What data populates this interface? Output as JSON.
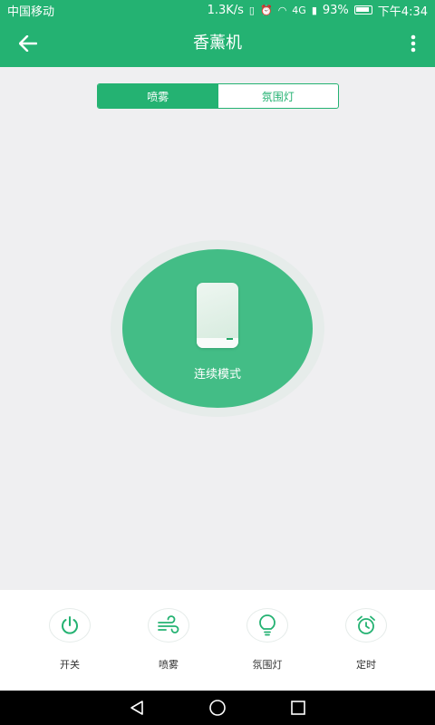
{
  "status_bar": {
    "carrier": "中国移动",
    "speed": "1.3K/s",
    "signal_text": "4G",
    "battery": "93%",
    "time": "下午4:34"
  },
  "header": {
    "title": "香薰机",
    "back_icon": "arrow-left-icon",
    "more_icon": "more-vertical-icon"
  },
  "tabs": [
    {
      "label": "喷雾",
      "active": true
    },
    {
      "label": "氛围灯",
      "active": false
    }
  ],
  "mode": {
    "label": "连续模式",
    "icon": "diffuser-device-icon"
  },
  "controls": [
    {
      "label": "开关",
      "icon": "power-icon"
    },
    {
      "label": "喷雾",
      "icon": "wind-icon"
    },
    {
      "label": "氛围灯",
      "icon": "bulb-icon"
    },
    {
      "label": "定时",
      "icon": "alarm-clock-icon"
    }
  ],
  "navigation": {
    "back": "triangle-back-icon",
    "home": "circle-home-icon",
    "recents": "square-recents-icon"
  },
  "colors": {
    "primary": "#24b272",
    "mode_circle": "#43bd86",
    "background": "#efeff1"
  }
}
